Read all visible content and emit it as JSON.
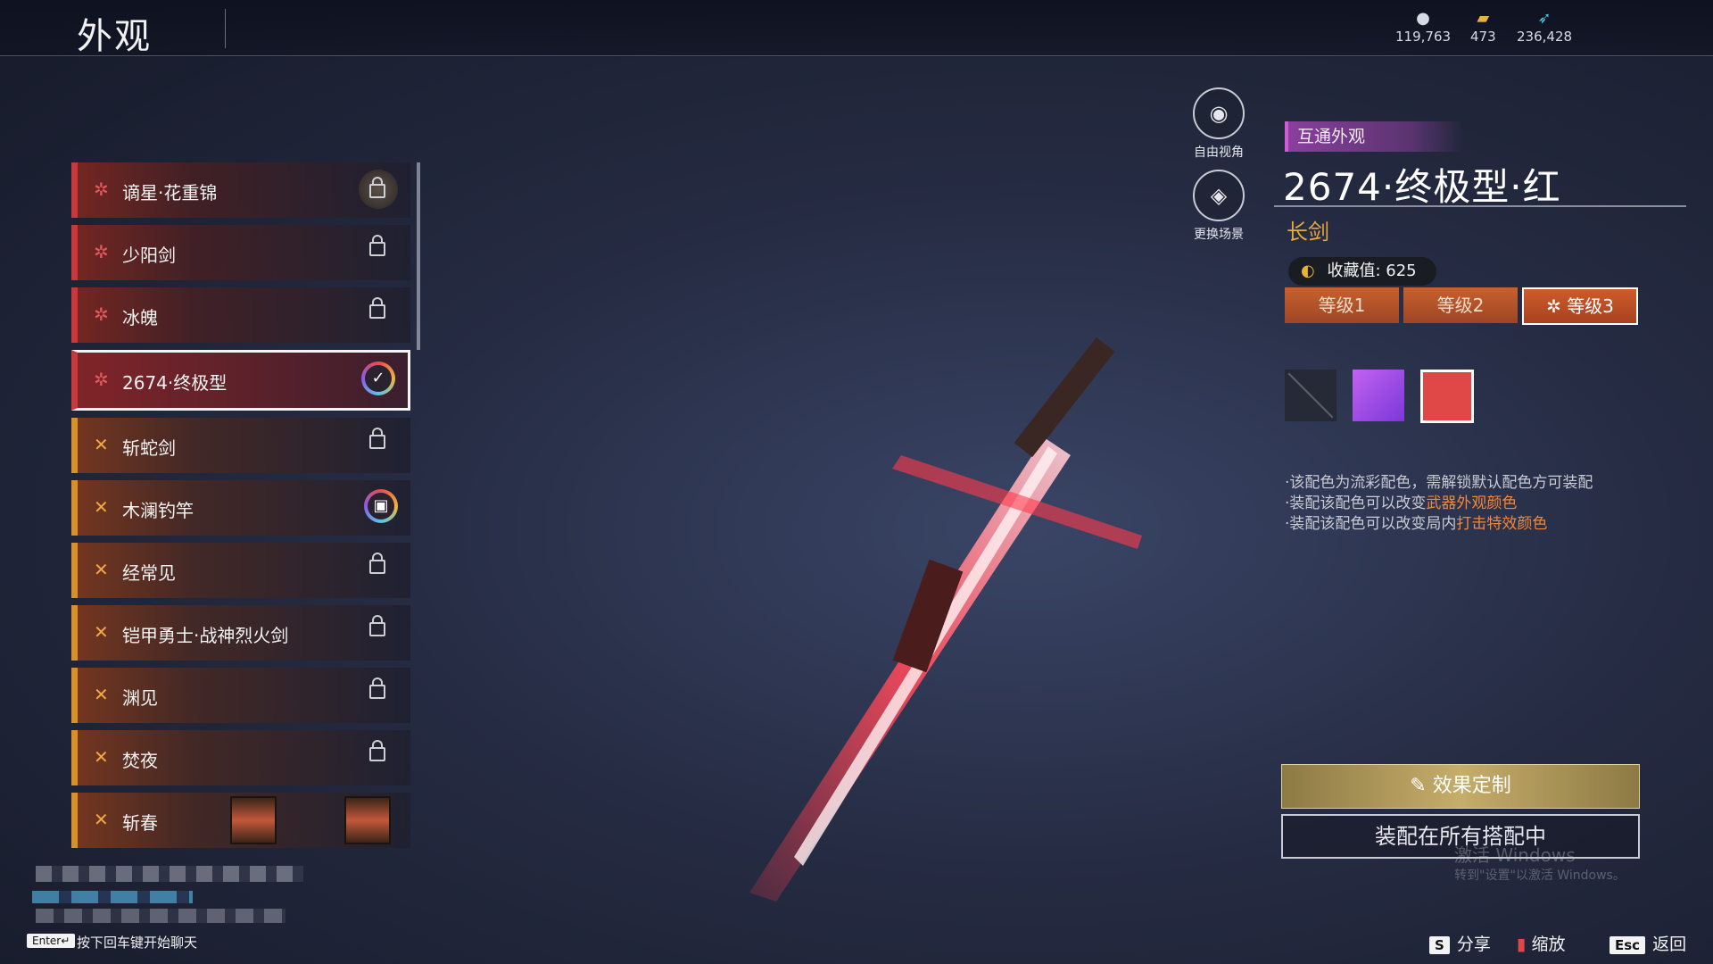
{
  "header": {
    "title": "外观",
    "currencies": [
      {
        "icon": "coin-icon",
        "value": "119,763"
      },
      {
        "icon": "ticket-icon",
        "value": "473"
      },
      {
        "icon": "feather-icon",
        "value": "236,428"
      }
    ]
  },
  "list": {
    "items": [
      {
        "label": "谪星·花重锦",
        "state": "locked-badge",
        "tier": "red"
      },
      {
        "label": "少阳剑",
        "state": "locked",
        "tier": "red"
      },
      {
        "label": "冰魄",
        "state": "locked",
        "tier": "red"
      },
      {
        "label": "2674·终极型",
        "state": "selected",
        "tier": "red"
      },
      {
        "label": "斩蛇剑",
        "state": "locked",
        "tier": "gold"
      },
      {
        "label": "木澜钓竿",
        "state": "locked-ring",
        "tier": "gold"
      },
      {
        "label": "经常见",
        "state": "locked",
        "tier": "gold"
      },
      {
        "label": "铠甲勇士·战神烈火剑",
        "state": "locked",
        "tier": "gold"
      },
      {
        "label": "渊见",
        "state": "locked",
        "tier": "gold"
      },
      {
        "label": "焚夜",
        "state": "locked",
        "tier": "gold"
      },
      {
        "label": "斩春",
        "state": "lantern",
        "tier": "gold"
      }
    ]
  },
  "side_buttons": {
    "free_view": "自由视角",
    "change_scene": "更换场景"
  },
  "detail": {
    "tag": "互通外观",
    "name": "2674·终极型·红",
    "type": "长剑",
    "collection": "收藏值: 625",
    "levels": [
      "等级1",
      "等级2",
      "等级3"
    ],
    "active_level_index": 2,
    "swatch_colors": [
      "#262a36",
      "#a04ce6",
      "#e04848"
    ],
    "notes": [
      {
        "prefix": "·该配色为流彩配色，需解锁默认配色方可装配",
        "highlight": ""
      },
      {
        "prefix": "·装配该配色可以改变",
        "highlight": "武器外观颜色"
      },
      {
        "prefix": "·装配该配色可以改变局内",
        "highlight": "打击特效颜色"
      }
    ],
    "custom_button": "效果定制",
    "equip_button": "装配在所有搭配中"
  },
  "bottom": {
    "enter_key": "Enter↵",
    "enter_hint": "按下回车键开始聊天",
    "hotkeys": [
      {
        "key": "S",
        "label": "分享"
      },
      {
        "key": "",
        "label": "缩放"
      },
      {
        "key": "Esc",
        "label": "返回"
      }
    ],
    "watermark": "激活 Windows",
    "watermark_sub": "转到\"设置\"以激活 Windows。"
  },
  "colors": {
    "accent_red": "#c9383a",
    "accent_gold": "#d7902a",
    "type_orange": "#e8a83c",
    "level_orange": "#c7612e"
  }
}
